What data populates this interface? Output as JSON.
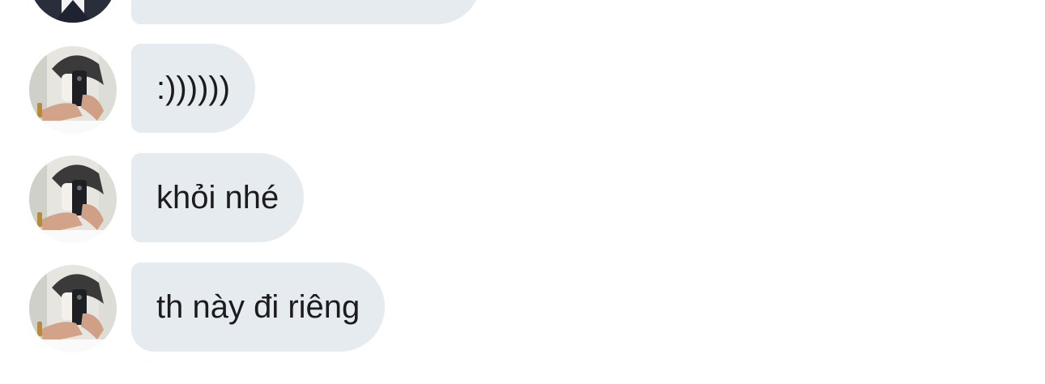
{
  "messages": [
    {
      "text": ""
    },
    {
      "text": ":))))))"
    },
    {
      "text": "khỏi nhé"
    },
    {
      "text": "th này đi riêng"
    }
  ],
  "colors": {
    "bubble_background": "#e6ebf0",
    "text": "#1c1c1e",
    "page_background": "#ffffff"
  },
  "icons": {
    "avatar": "user-avatar-photo"
  }
}
